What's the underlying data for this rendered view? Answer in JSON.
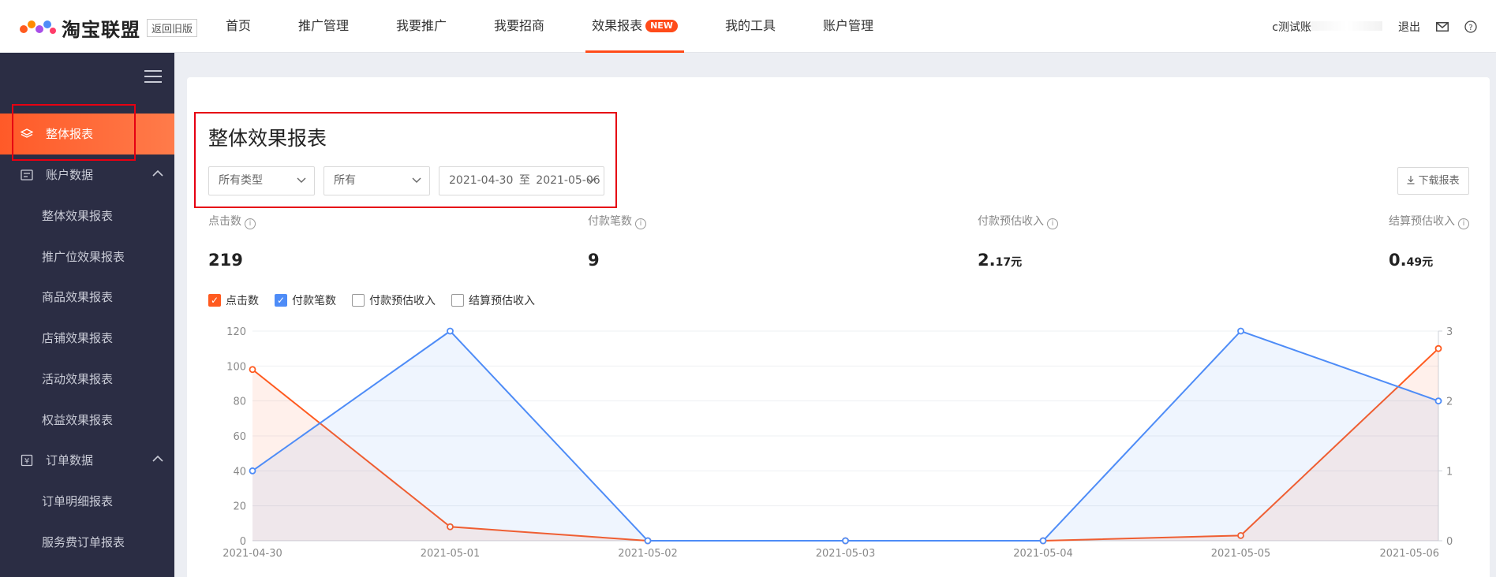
{
  "header": {
    "brand": "淘宝联盟",
    "old_version": "返回旧版",
    "nav": [
      {
        "label": "首页",
        "active": false
      },
      {
        "label": "推广管理",
        "active": false
      },
      {
        "label": "我要推广",
        "active": false
      },
      {
        "label": "我要招商",
        "active": false
      },
      {
        "label": "效果报表",
        "active": true,
        "badge": "NEW"
      },
      {
        "label": "我的工具",
        "active": false
      },
      {
        "label": "账户管理",
        "active": false
      }
    ],
    "user": "c测试账",
    "logout": "退出",
    "mail_icon": "mail-icon",
    "help_icon": "help-icon"
  },
  "sidebar": {
    "menu_icon": "hamburger-icon",
    "items": [
      {
        "label": "整体报表",
        "icon": "layers-icon",
        "active": true
      },
      {
        "label": "账户数据",
        "icon": "account-icon",
        "expanded": true,
        "children": [
          "整体效果报表",
          "推广位效果报表",
          "商品效果报表",
          "店铺效果报表",
          "活动效果报表",
          "权益效果报表"
        ]
      },
      {
        "label": "订单数据",
        "icon": "order-icon",
        "expanded": true,
        "children": [
          "订单明细报表",
          "服务费订单报表"
        ]
      }
    ]
  },
  "main": {
    "title": "整体效果报表",
    "filters": {
      "type": "所有类型",
      "scope": "所有",
      "date_start": "2021-04-30",
      "date_sep": "至",
      "date_end": "2021-05-06"
    },
    "download": "下载报表",
    "metrics": [
      {
        "label": "点击数",
        "value": "219",
        "unit": ""
      },
      {
        "label": "付款笔数",
        "value": "9",
        "unit": ""
      },
      {
        "label": "付款预估收入",
        "value": "2.",
        "decimals": "17",
        "unit": "元"
      },
      {
        "label": "结算预估收入",
        "value": "0.",
        "decimals": "49",
        "unit": "元"
      }
    ],
    "legend": [
      {
        "label": "点击数",
        "checked": true,
        "color": "#ff5a1f"
      },
      {
        "label": "付款笔数",
        "checked": true,
        "color": "#4e8cf7"
      },
      {
        "label": "付款预估收入",
        "checked": false
      },
      {
        "label": "结算预估收入",
        "checked": false
      }
    ]
  },
  "chart_data": {
    "type": "area",
    "x": [
      "2021-04-30",
      "2021-05-01",
      "2021-05-02",
      "2021-05-03",
      "2021-05-04",
      "2021-05-05",
      "2021-05-06"
    ],
    "series": [
      {
        "name": "点击数",
        "axis": "left",
        "color": "#ff5a1f",
        "values": [
          98,
          8,
          0,
          0,
          0,
          3,
          110
        ]
      },
      {
        "name": "付款笔数",
        "axis": "right",
        "color": "#4e8cf7",
        "values": [
          1,
          3,
          0,
          0,
          0,
          3,
          2
        ]
      }
    ],
    "yleft": {
      "ticks": [
        0,
        20,
        40,
        60,
        80,
        100,
        120
      ],
      "lim": [
        0,
        120
      ]
    },
    "yright": {
      "ticks": [
        0,
        1,
        2,
        3
      ],
      "lim": [
        0,
        3
      ]
    },
    "grid": true
  }
}
